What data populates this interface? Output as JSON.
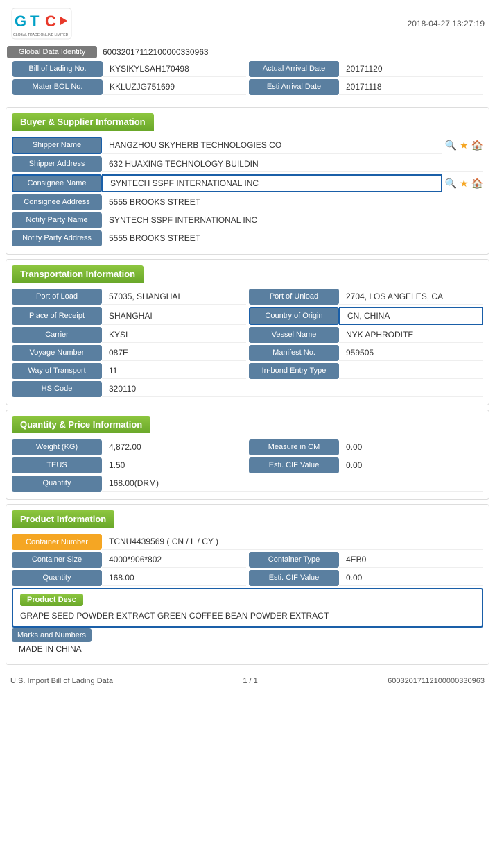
{
  "header": {
    "datetime": "2018-04-27 13:27:19"
  },
  "identity": {
    "global_data_label": "Global Data Identity",
    "global_data_value": "60032017112100000330963",
    "bol_label": "Bill of Lading No.",
    "bol_value": "KYSIKYLSAH170498",
    "actual_arrival_label": "Actual Arrival Date",
    "actual_arrival_value": "20171120",
    "master_bol_label": "Mater BOL No.",
    "master_bol_value": "KKLUZJG751699",
    "esti_arrival_label": "Esti Arrival Date",
    "esti_arrival_value": "20171118"
  },
  "buyer_supplier": {
    "section_title": "Buyer & Supplier Information",
    "shipper_name_label": "Shipper Name",
    "shipper_name_value": "HANGZHOU SKYHERB TECHNOLOGIES CO",
    "shipper_address_label": "Shipper Address",
    "shipper_address_value": "632 HUAXING TECHNOLOGY BUILDIN",
    "consignee_name_label": "Consignee Name",
    "consignee_name_value": "SYNTECH SSPF INTERNATIONAL INC",
    "consignee_address_label": "Consignee Address",
    "consignee_address_value": "5555 BROOKS STREET",
    "notify_party_name_label": "Notify Party Name",
    "notify_party_name_value": "SYNTECH SSPF INTERNATIONAL INC",
    "notify_party_address_label": "Notify Party Address",
    "notify_party_address_value": "5555 BROOKS STREET"
  },
  "transportation": {
    "section_title": "Transportation Information",
    "port_of_load_label": "Port of Load",
    "port_of_load_value": "57035, SHANGHAI",
    "port_of_unload_label": "Port of Unload",
    "port_of_unload_value": "2704, LOS ANGELES, CA",
    "place_of_receipt_label": "Place of Receipt",
    "place_of_receipt_value": "SHANGHAI",
    "country_of_origin_label": "Country of Origin",
    "country_of_origin_value": "CN, CHINA",
    "carrier_label": "Carrier",
    "carrier_value": "KYSI",
    "vessel_name_label": "Vessel Name",
    "vessel_name_value": "NYK APHRODITE",
    "voyage_number_label": "Voyage Number",
    "voyage_number_value": "087E",
    "manifest_no_label": "Manifest No.",
    "manifest_no_value": "959505",
    "way_of_transport_label": "Way of Transport",
    "way_of_transport_value": "11",
    "in_bond_entry_label": "In-bond Entry Type",
    "in_bond_entry_value": "",
    "hs_code_label": "HS Code",
    "hs_code_value": "320110"
  },
  "quantity_price": {
    "section_title": "Quantity & Price Information",
    "weight_label": "Weight (KG)",
    "weight_value": "4,872.00",
    "measure_in_cm_label": "Measure in CM",
    "measure_in_cm_value": "0.00",
    "teus_label": "TEUS",
    "teus_value": "1.50",
    "esti_cif_label": "Esti. CIF Value",
    "esti_cif_value": "0.00",
    "quantity_label": "Quantity",
    "quantity_value": "168.00(DRM)"
  },
  "product_info": {
    "section_title": "Product Information",
    "container_number_label": "Container Number",
    "container_number_value": "TCNU4439569 ( CN / L / CY )",
    "container_size_label": "Container Size",
    "container_size_value": "4000*906*802",
    "container_type_label": "Container Type",
    "container_type_value": "4EB0",
    "quantity_label": "Quantity",
    "quantity_value": "168.00",
    "esti_cif_label": "Esti. CIF Value",
    "esti_cif_value": "0.00",
    "product_desc_label": "Product Desc",
    "product_desc_value": "GRAPE SEED POWDER EXTRACT GREEN COFFEE BEAN POWDER EXTRACT",
    "marks_label": "Marks and Numbers",
    "marks_value": "MADE IN CHINA"
  },
  "footer": {
    "left": "U.S. Import Bill of Lading Data",
    "page": "1 / 1",
    "right": "60032017112100000330963"
  }
}
